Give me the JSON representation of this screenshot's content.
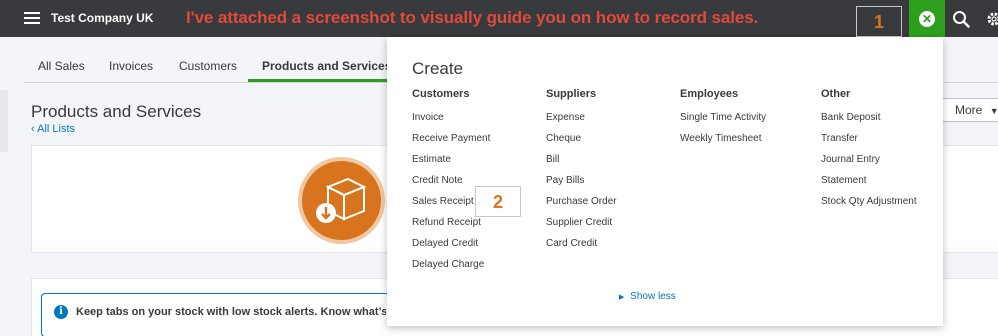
{
  "topbar": {
    "company_name": "Test Company UK",
    "caption": "I've attached a screenshot to visually guide you on how to record sales.",
    "callout_1": "1",
    "close_glyph": "✕"
  },
  "tabs": [
    {
      "label": "All Sales"
    },
    {
      "label": "Invoices"
    },
    {
      "label": "Customers"
    },
    {
      "label": "Products and Services"
    }
  ],
  "page": {
    "title": "Products and Services",
    "back_link": "All Lists",
    "more_label": "More"
  },
  "alert": {
    "info_glyph": "i",
    "text": "Keep tabs on your stock with low stock alerts. Know what’s running low"
  },
  "create": {
    "title": "Create",
    "callout_2": "2",
    "show_less": "Show less",
    "columns": [
      {
        "heading": "Customers",
        "items": [
          "Invoice",
          "Receive Payment",
          "Estimate",
          "Credit Note",
          "Sales Receipt",
          "Refund Receipt",
          "Delayed Credit",
          "Delayed Charge"
        ]
      },
      {
        "heading": "Suppliers",
        "items": [
          "Expense",
          "Cheque",
          "Bill",
          "Pay Bills",
          "Purchase Order",
          "Supplier Credit",
          "Card Credit"
        ]
      },
      {
        "heading": "Employees",
        "items": [
          "Single Time Activity",
          "Weekly Timesheet"
        ]
      },
      {
        "heading": "Other",
        "items": [
          "Bank Deposit",
          "Transfer",
          "Journal Entry",
          "Statement",
          "Stock Qty Adjustment"
        ]
      }
    ]
  },
  "colors": {
    "topbar": "#393a3d",
    "accent_green": "#2ca01c",
    "link_blue": "#0077c5",
    "callout_orange": "#d9741e",
    "caption_red": "#e04a3a"
  },
  "icons": [
    "menu-icon",
    "close-icon",
    "search-icon",
    "gear-icon",
    "info-icon",
    "box-download-icon",
    "chevron-left-icon",
    "caret-down-icon",
    "caret-right-icon"
  ]
}
